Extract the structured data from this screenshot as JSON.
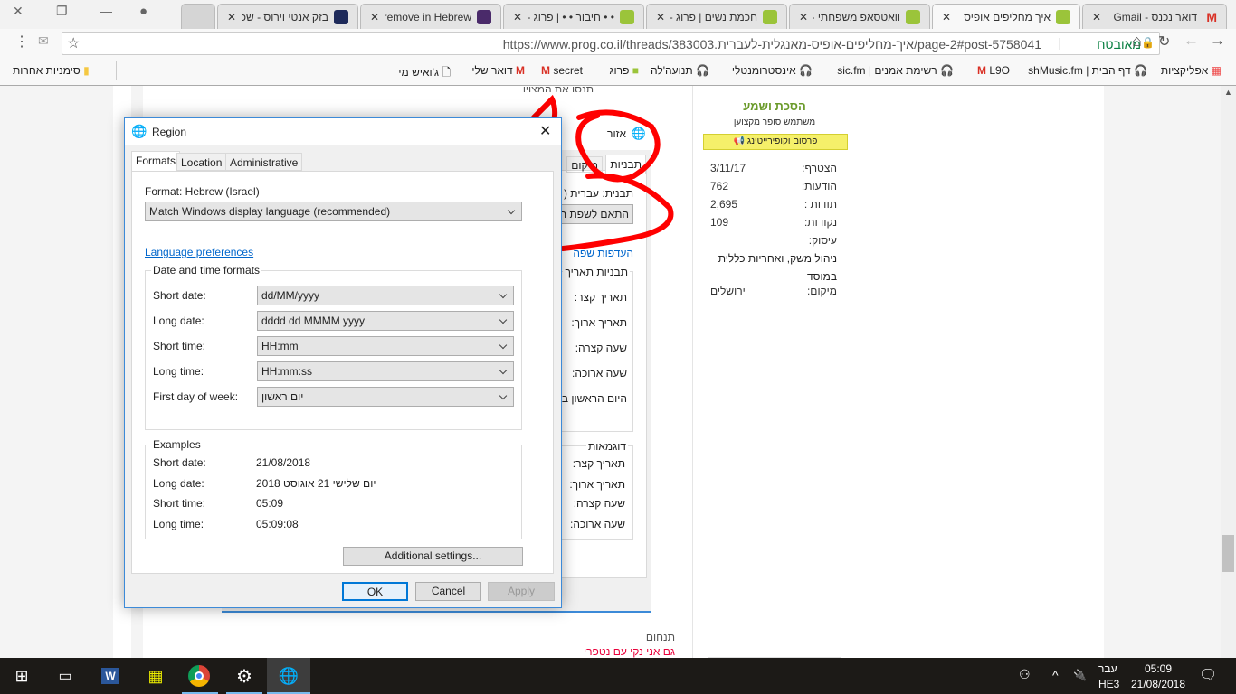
{
  "browser": {
    "tabs": [
      {
        "title": "דואר נכנס - Gmail",
        "favicon": "gmail-icon"
      },
      {
        "title": "איך מחליפים אופיס",
        "favicon": "prog-icon",
        "active": true
      },
      {
        "title": "וואטסאפ משפחתי -",
        "favicon": "prog-icon"
      },
      {
        "title": "חכמת נשים | פרוג -",
        "favicon": "prog-icon"
      },
      {
        "title": "• • חיבור • • | פרוג -",
        "favicon": "prog-icon"
      },
      {
        "title": "remove in Hebrew",
        "favicon": "morfix-icon"
      },
      {
        "title": "בזק אנטי וירוס - שכ",
        "favicon": "bezeq-icon"
      }
    ],
    "url": "https://www.prog.co.il/threads/383003.איך-מחליפים-אופיס-מאנגלית-לעברית/page-2#post-5758041",
    "secure_label": "מאובטח",
    "bookmarks": [
      "אפליקציות",
      "דף הבית | shMusic.fm",
      "L9O",
      "רשימת אמנים | sic.fm",
      "אינסטרומנטלי",
      "תנועה'לה",
      "פרוג",
      "secret",
      "דואר שלי",
      "ג'ואיש מי"
    ],
    "other_bookmarks": "סימניות אחרות"
  },
  "post": {
    "top_text": "תנסו את המצוין",
    "signature_label": "תנחום",
    "signature_text": "גם אני נקי עם נטפרי"
  },
  "sidebar": {
    "username": "הסכת ושמע",
    "user_title": "משתמש סופר מקצוען",
    "banner": "פרסום וקופירייטינג",
    "stats": [
      {
        "label": "הצטרף:",
        "value": "3/11/17"
      },
      {
        "label": "הודעות:",
        "value": "762"
      },
      {
        "label": "תודות :",
        "value": "2,695"
      },
      {
        "label": "נקודות:",
        "value": "109"
      }
    ],
    "occupation_label": "עיסוק:",
    "occupation_value": "ניהול משק, ואחריות כללית במוסד",
    "location_label": "מיקום:",
    "location_value": "ירושלים"
  },
  "bg_dialog": {
    "title": "אזור",
    "tabs": [
      "תבניות",
      "מיקום"
    ],
    "format": "תבנית: עברית (",
    "combo": "התאם לשפת ה",
    "link": "העדפות שפה",
    "group1": "תבניות תאריך",
    "rows1": [
      "תאריך קצר:",
      "תאריך ארוך:",
      "שעה קצרה:",
      "שעה ארוכה:",
      "היום הראשון ב"
    ],
    "group2": "דוגמאות",
    "rows2": [
      "תאריך קצר:",
      "תאריך ארוך:",
      "שעה קצרה:",
      "שעה ארוכה:"
    ]
  },
  "region": {
    "title": "Region",
    "tabs": [
      "Formats",
      "Location",
      "Administrative"
    ],
    "format_label": "Format: Hebrew (Israel)",
    "format_value": "Match Windows display language (recommended)",
    "lang_link": "Language preferences",
    "dt_group": "Date and time formats",
    "dt_rows": [
      {
        "label": "Short date:",
        "value": "dd/MM/yyyy"
      },
      {
        "label": "Long date:",
        "value": "dddd dd MMMM yyyy"
      },
      {
        "label": "Short time:",
        "value": "HH:mm"
      },
      {
        "label": "Long time:",
        "value": "HH:mm:ss"
      },
      {
        "label": "First day of week:",
        "value": "יום ראשון"
      }
    ],
    "ex_group": "Examples",
    "ex_rows": [
      {
        "label": "Short date:",
        "value": "21/08/2018"
      },
      {
        "label": "Long date:",
        "value": "יום שלישי 21 אוגוסט 2018"
      },
      {
        "label": "Short time:",
        "value": "05:09"
      },
      {
        "label": "Long time:",
        "value": "05:09:08"
      }
    ],
    "additional": "Additional settings...",
    "ok": "OK",
    "cancel": "Cancel",
    "apply": "Apply"
  },
  "taskbar": {
    "lang_top": "עבר",
    "lang_bottom": "HE3",
    "time": "05:09",
    "date": "21/08/2018"
  },
  "colors": {
    "accent": "#3c8ad8",
    "annotation": "#ff0000",
    "sidebar_name": "#6a9a2a",
    "banner": "#f5f06a"
  }
}
